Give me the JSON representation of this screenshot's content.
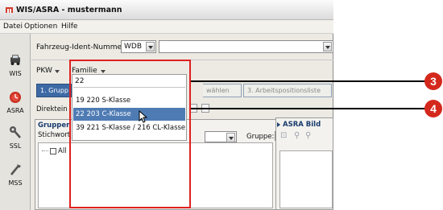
{
  "window": {
    "title": "WIS/ASRA - mustermann"
  },
  "menu": {
    "items": [
      "Datei",
      "Optionen",
      "Hilfe"
    ]
  },
  "sidebar": {
    "items": [
      {
        "label": "WIS",
        "icon": "car-icon"
      },
      {
        "label": "ASRA",
        "icon": "clock-icon"
      },
      {
        "label": "SSL",
        "icon": "wrench-icon"
      },
      {
        "label": "MSS",
        "icon": "tool-icon"
      }
    ]
  },
  "vehicle": {
    "label": "Fahrzeug-Ident-Nummer",
    "prefix_value": "WDB",
    "number_value": ""
  },
  "classification": {
    "type_label": "PKW",
    "family_label": "Familie"
  },
  "tabs": [
    {
      "label": "1. Grupp"
    },
    {
      "label": "wählen"
    },
    {
      "label": "3. Arbeitspositionsliste"
    }
  ],
  "direct_entry": {
    "label": "Direktein"
  },
  "groups_panel": {
    "title": "Gruppen",
    "keyword_label": "Stichwort",
    "group_label": "Gruppe:",
    "group_value": "",
    "tree_root": "All"
  },
  "asra_panel": {
    "title": "ASRA Bild"
  },
  "family_dropdown": {
    "input_value": "22",
    "options": [
      "19 220 S-Klasse",
      "22 203 C-Klasse",
      "39 221 S-Klasse / 216 CL-Klasse"
    ],
    "selected_index": 1
  },
  "callouts": [
    {
      "number": "3",
      "color": "#d4281c"
    },
    {
      "number": "4",
      "color": "#d4281c"
    }
  ],
  "colors": {
    "accent_blue": "#3d6aa5",
    "selection_blue": "#4e7bb3",
    "highlight_red": "#e02020"
  }
}
